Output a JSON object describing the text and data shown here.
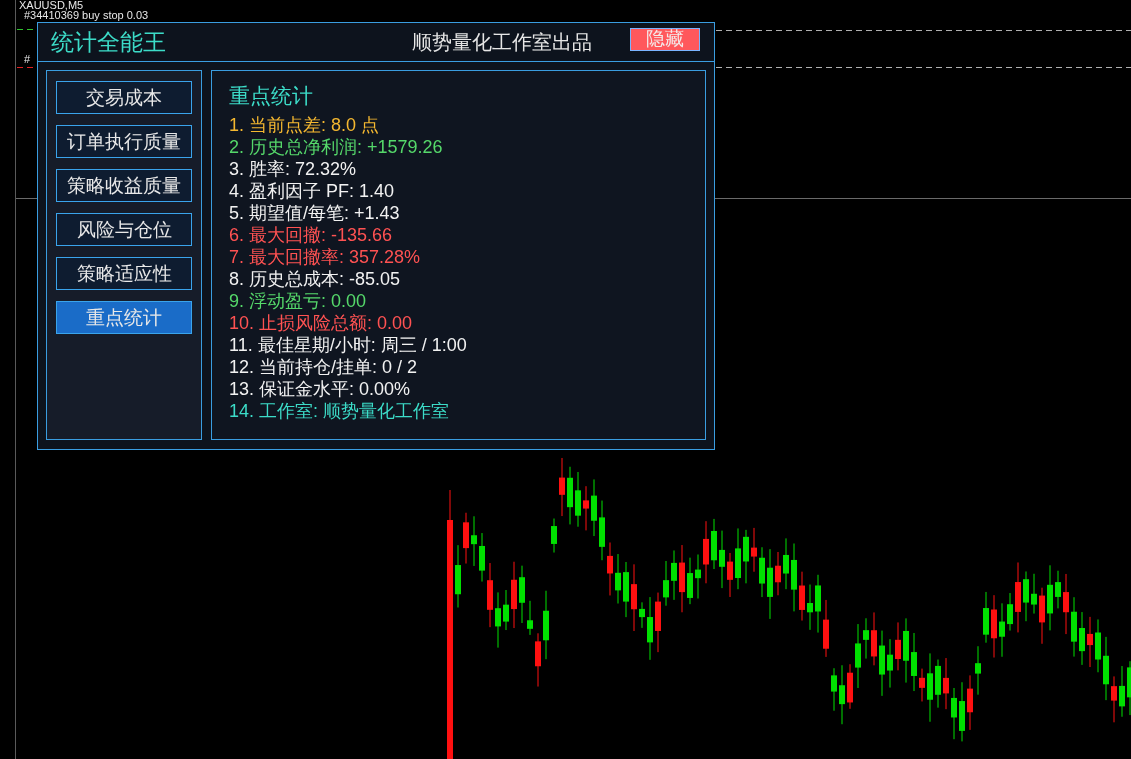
{
  "chart_header": {
    "symbol": "XAUUSD,M5",
    "order_labels": [
      "#34410369 buy stop 0.03",
      "#"
    ]
  },
  "panel": {
    "title": "统计全能王",
    "subtitle": "顺势量化工作室出品",
    "hide_button": "隐藏"
  },
  "nav_buttons": [
    {
      "label": "交易成本",
      "selected": false
    },
    {
      "label": "订单执行质量",
      "selected": false
    },
    {
      "label": "策略收益质量",
      "selected": false
    },
    {
      "label": "风险与仓位",
      "selected": false
    },
    {
      "label": "策略适应性",
      "selected": false
    },
    {
      "label": "重点统计",
      "selected": true
    }
  ],
  "stats": {
    "heading": "重点统计",
    "items": [
      {
        "text": "1. 当前点差: 8.0 点",
        "color": "#f5b830"
      },
      {
        "text": "2. 历史总净利润: +1579.26",
        "color": "#55d86a"
      },
      {
        "text": "3. 胜率: 72.32%",
        "color": "#f2f2f2"
      },
      {
        "text": "4. 盈利因子 PF: 1.40",
        "color": "#f2f2f2"
      },
      {
        "text": "5. 期望值/每笔: +1.43",
        "color": "#f2f2f2"
      },
      {
        "text": "6. 最大回撤: -135.66",
        "color": "#ff5252"
      },
      {
        "text": "7. 最大回撤率: 357.28%",
        "color": "#ff5252"
      },
      {
        "text": "8. 历史总成本: -85.05",
        "color": "#f2f2f2"
      },
      {
        "text": "9. 浮动盈亏: 0.00",
        "color": "#55d86a"
      },
      {
        "text": "10. 止损风险总额: 0.00",
        "color": "#ff5252"
      },
      {
        "text": "11. 最佳星期/小时: 周三 / 1:00",
        "color": "#f2f2f2"
      },
      {
        "text": "12. 当前持仓/挂单: 0 / 2",
        "color": "#f2f2f2"
      },
      {
        "text": "13. 保证金水平: 0.00%",
        "color": "#f2f2f2"
      },
      {
        "text": "14. 工作室: 顺势量化工作室",
        "color": "#3cdcc8"
      }
    ]
  }
}
